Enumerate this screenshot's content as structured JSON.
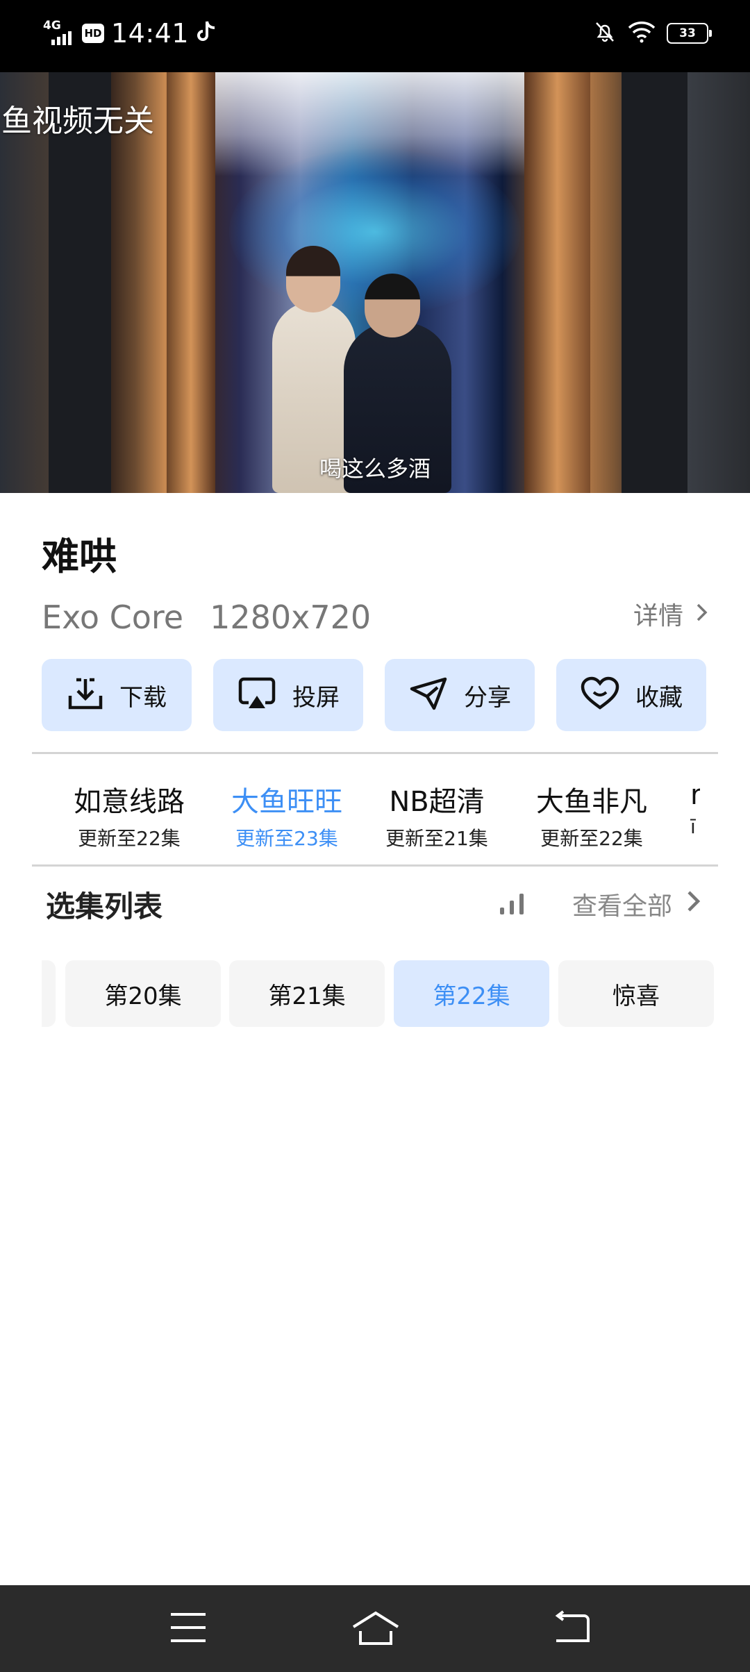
{
  "status_bar": {
    "network": "4G",
    "hd_badge": "HD",
    "time": "14:41",
    "battery": "33"
  },
  "video": {
    "watermark": "鱼视频无关",
    "subtitle": "喝这么多酒"
  },
  "info": {
    "title": "难哄",
    "player_core": "Exo Core",
    "resolution": "1280x720",
    "details_label": "详情"
  },
  "actions": [
    {
      "label": "下载",
      "icon": "download-icon"
    },
    {
      "label": "投屏",
      "icon": "cast-icon"
    },
    {
      "label": "分享",
      "icon": "share-icon"
    },
    {
      "label": "收藏",
      "icon": "heart-icon"
    }
  ],
  "sources": [
    {
      "name": "如意线路",
      "update": "更新至22集"
    },
    {
      "name": "大鱼旺旺",
      "update": "更新至23集",
      "active": true
    },
    {
      "name": "NB超清",
      "update": "更新至21集"
    },
    {
      "name": "大鱼非凡",
      "update": "更新至22集"
    },
    {
      "name": "r",
      "update": "ī"
    }
  ],
  "episodes_section": {
    "title": "选集列表",
    "view_all": "查看全部"
  },
  "episodes": [
    {
      "label": "第20集"
    },
    {
      "label": "第21集"
    },
    {
      "label": "第22集",
      "active": true
    },
    {
      "label": "惊喜"
    }
  ],
  "colors": {
    "accent": "#3d8ff5",
    "button_bg": "#dbe9ff",
    "episode_bg": "#f5f5f5",
    "muted_text": "#777777",
    "nav_bar_bg": "#2b2b2b"
  }
}
